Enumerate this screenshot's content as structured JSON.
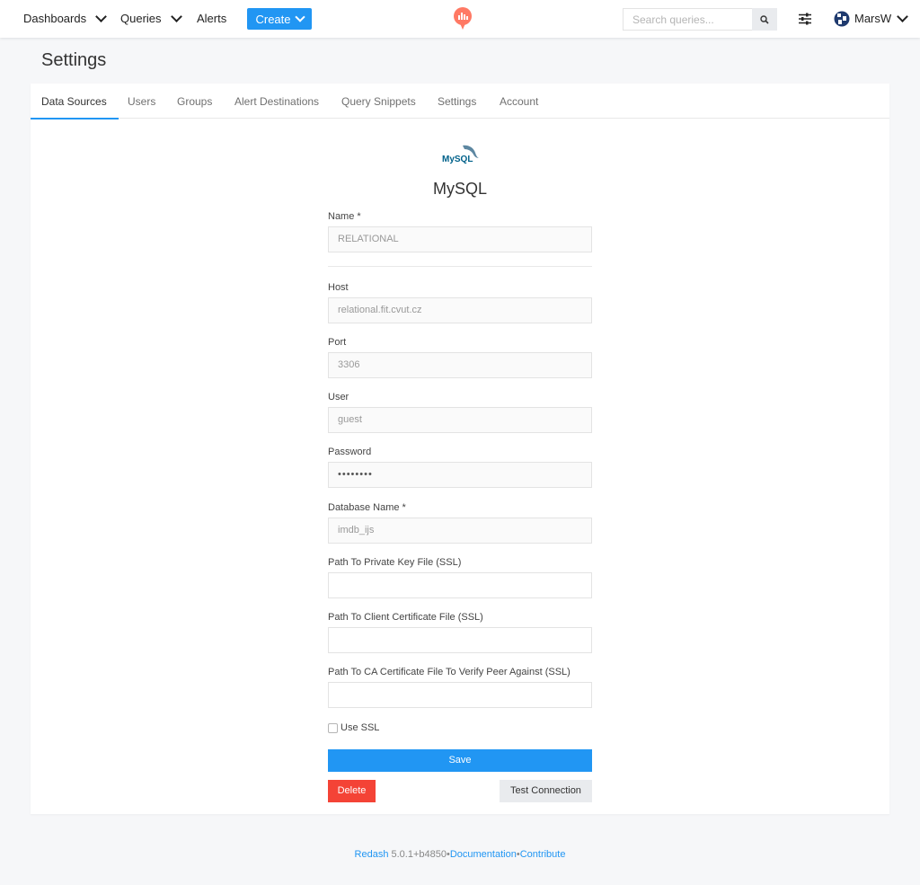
{
  "nav": {
    "dashboards": "Dashboards",
    "queries": "Queries",
    "alerts": "Alerts",
    "create": "Create",
    "search_placeholder": "Search queries...",
    "user_name": "MarsW"
  },
  "page": {
    "title": "Settings"
  },
  "tabs": [
    {
      "label": "Data Sources",
      "active": true
    },
    {
      "label": "Users"
    },
    {
      "label": "Groups"
    },
    {
      "label": "Alert Destinations"
    },
    {
      "label": "Query Snippets"
    },
    {
      "label": "Settings"
    },
    {
      "label": "Account"
    }
  ],
  "datasource": {
    "logo_text": "MySQL",
    "title": "MySQL",
    "fields": {
      "name": {
        "label": "Name *",
        "value": "RELATIONAL"
      },
      "host": {
        "label": "Host",
        "value": "relational.fit.cvut.cz"
      },
      "port": {
        "label": "Port",
        "value": "3306"
      },
      "user": {
        "label": "User",
        "value": "guest"
      },
      "password": {
        "label": "Password",
        "value": "••••••••"
      },
      "database": {
        "label": "Database Name *",
        "value": "imdb_ijs"
      },
      "private_key": {
        "label": "Path To Private Key File (SSL)",
        "value": ""
      },
      "client_cert": {
        "label": "Path To Client Certificate File (SSL)",
        "value": ""
      },
      "ca_cert": {
        "label": "Path To CA Certificate File To Verify Peer Against (SSL)",
        "value": ""
      }
    },
    "use_ssl_label": "Use SSL",
    "use_ssl_checked": false,
    "save_label": "Save",
    "delete_label": "Delete",
    "test_label": "Test Connection"
  },
  "footer": {
    "brand": "Redash",
    "version": "5.0.1+b4850",
    "sep1": "•",
    "documentation": "Documentation",
    "sep2": "•",
    "contribute": "Contribute"
  },
  "colors": {
    "primary": "#2196f3",
    "danger": "#f44336",
    "brand_red": "#ff7964"
  }
}
